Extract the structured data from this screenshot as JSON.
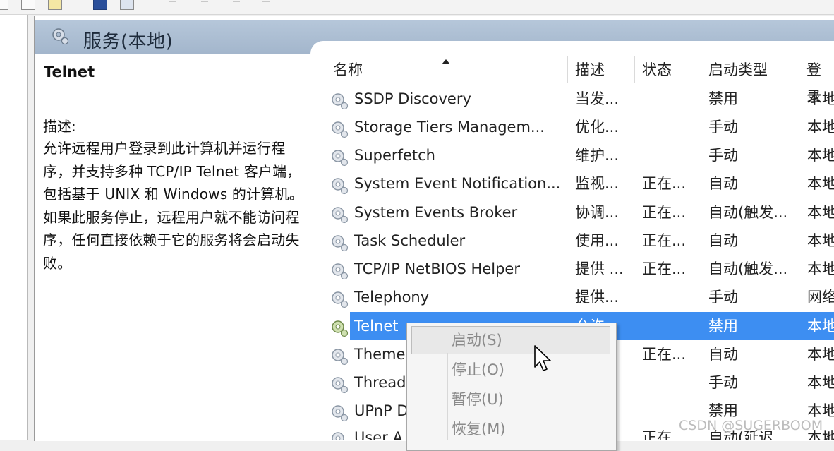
{
  "header": {
    "title": "服务(本地)"
  },
  "description": {
    "service_name": "Telnet",
    "label": "描述:",
    "text": "允许远程用户登录到此计算机并运行程序，并支持多种 TCP/IP Telnet 客户端，包括基于 UNIX 和 Windows 的计算机。如果此服务停止，远程用户就不能访问程序，任何直接依赖于它的服务将会启动失败。"
  },
  "table": {
    "columns": [
      "名称",
      "描述",
      "状态",
      "启动类型",
      "登录"
    ],
    "rows": [
      {
        "name": "SSDP Discovery",
        "desc": "当发...",
        "status": "",
        "startup": "禁用",
        "logon": "本地"
      },
      {
        "name": "Storage Tiers Managem...",
        "desc": "优化...",
        "status": "",
        "startup": "手动",
        "logon": "本地"
      },
      {
        "name": "Superfetch",
        "desc": "维护...",
        "status": "",
        "startup": "手动",
        "logon": "本地"
      },
      {
        "name": "System Event Notification...",
        "desc": "监视...",
        "status": "正在...",
        "startup": "自动",
        "logon": "本地"
      },
      {
        "name": "System Events Broker",
        "desc": "协调...",
        "status": "正在...",
        "startup": "自动(触发...",
        "logon": "本地"
      },
      {
        "name": "Task Scheduler",
        "desc": "使用...",
        "status": "正在...",
        "startup": "自动",
        "logon": "本地"
      },
      {
        "name": "TCP/IP NetBIOS Helper",
        "desc": "提供 ...",
        "status": "正在...",
        "startup": "自动(触发...",
        "logon": "本地"
      },
      {
        "name": "Telephony",
        "desc": "提供...",
        "status": "",
        "startup": "手动",
        "logon": "网络"
      },
      {
        "name": "Telnet",
        "desc": "允许...",
        "status": "",
        "startup": "禁用",
        "logon": "本地"
      },
      {
        "name": "Theme",
        "desc": "...",
        "status": "正在...",
        "startup": "自动",
        "logon": "本地"
      },
      {
        "name": "Thread",
        "desc": "...",
        "status": "",
        "startup": "手动",
        "logon": "本地"
      },
      {
        "name": "UPnP D",
        "desc": "...",
        "status": "",
        "startup": "禁用",
        "logon": "本地"
      },
      {
        "name": "User A",
        "desc": "",
        "status": "正在",
        "startup": "自动(延迟",
        "logon": "本地"
      }
    ]
  },
  "context_menu": {
    "items": [
      "启动(S)",
      "停止(O)",
      "暂停(U)",
      "恢复(M)"
    ]
  },
  "watermark": "CSDN @SUGERBOOM",
  "colors": {
    "selection": "#3d8ef2",
    "header_band": "#a9bbd0",
    "menu_disabled_text": "#8a8a8a"
  }
}
